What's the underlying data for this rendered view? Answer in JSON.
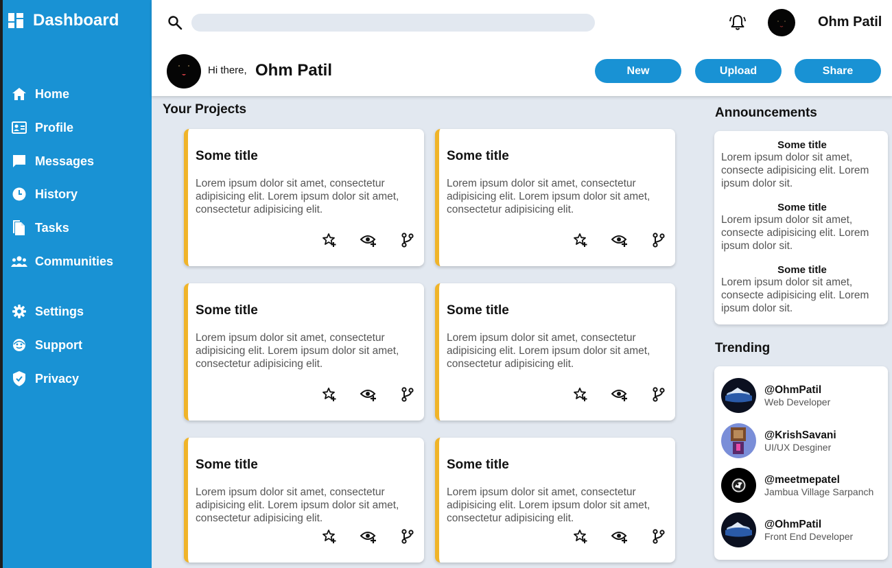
{
  "sidebar": {
    "brand": "Dashboard",
    "items": [
      {
        "label": "Home",
        "icon": "home-icon"
      },
      {
        "label": "Profile",
        "icon": "id-card-icon"
      },
      {
        "label": "Messages",
        "icon": "message-icon"
      },
      {
        "label": "History",
        "icon": "clock-icon"
      },
      {
        "label": "Tasks",
        "icon": "document-icon"
      },
      {
        "label": "Communities",
        "icon": "group-icon"
      },
      {
        "label": "Settings",
        "icon": "gear-icon"
      },
      {
        "label": "Support",
        "icon": "support-icon"
      },
      {
        "label": "Privacy",
        "icon": "shield-icon"
      }
    ]
  },
  "header": {
    "search_placeholder": "",
    "user_name": "Ohm Patil",
    "greeting": "Hi there,",
    "greeting_name": "Ohm Patil",
    "buttons": {
      "new": "New",
      "upload": "Upload",
      "share": "Share"
    }
  },
  "projects": {
    "title": "Your Projects",
    "cards": [
      {
        "title": "Some title",
        "body": "Lorem ipsum dolor sit amet, consectetur adipisicing elit. Lorem ipsum dolor sit amet, consectetur adipisicing elit."
      },
      {
        "title": "Some title",
        "body": "Lorem ipsum dolor sit amet, consectetur adipisicing elit. Lorem ipsum dolor sit amet, consectetur adipisicing elit."
      },
      {
        "title": "Some title",
        "body": "Lorem ipsum dolor sit amet, consectetur adipisicing elit. Lorem ipsum dolor sit amet, consectetur adipisicing elit."
      },
      {
        "title": "Some title",
        "body": "Lorem ipsum dolor sit amet, consectetur adipisicing elit. Lorem ipsum dolor sit amet, consectetur adipisicing elit."
      },
      {
        "title": "Some title",
        "body": "Lorem ipsum dolor sit amet, consectetur adipisicing elit. Lorem ipsum dolor sit amet, consectetur adipisicing elit."
      },
      {
        "title": "Some title",
        "body": "Lorem ipsum dolor sit amet, consectetur adipisicing elit. Lorem ipsum dolor sit amet, consectetur adipisicing elit."
      }
    ],
    "card_actions": [
      "star-add-icon",
      "watch-icon",
      "fork-icon"
    ]
  },
  "announcements": {
    "title": "Announcements",
    "items": [
      {
        "title": "Some title",
        "body": "Lorem ipsum dolor sit amet, consecte adipisicing elit. Lorem ipsum dolor sit."
      },
      {
        "title": "Some title",
        "body": "Lorem ipsum dolor sit amet, consecte adipisicing elit. Lorem ipsum dolor sit."
      },
      {
        "title": "Some title",
        "body": "Lorem ipsum dolor sit amet, consecte adipisicing elit. Lorem ipsum dolor sit."
      }
    ]
  },
  "trending": {
    "title": "Trending",
    "items": [
      {
        "handle": "@OhmPatil",
        "role": "Web Developer"
      },
      {
        "handle": "@KrishSavani",
        "role": "UI/UX Desginer"
      },
      {
        "handle": "@meetmepatel",
        "role": "Jambua Village Sarpanch"
      },
      {
        "handle": "@OhmPatil",
        "role": "Front End Developer"
      }
    ]
  },
  "colors": {
    "sidebar": "#1992d4",
    "accent": "#f0b429",
    "background": "#e2e8f0",
    "button": "#1992d4"
  }
}
